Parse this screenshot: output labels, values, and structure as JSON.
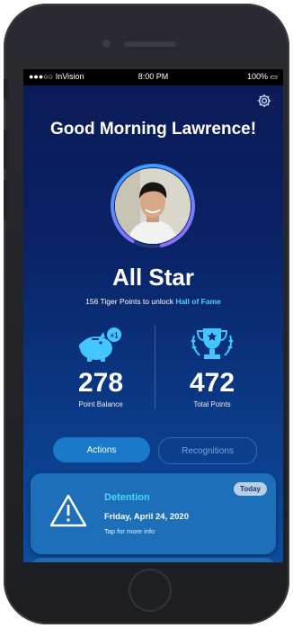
{
  "status_bar": {
    "signal": "●●●○○",
    "carrier": "InVision",
    "time": "8:00 PM",
    "battery": "100%"
  },
  "header": {
    "greeting": "Good Morning Lawrence!",
    "settings_icon": "gear-icon"
  },
  "profile": {
    "rank": "All Star",
    "unlock_prefix": "156 Tiger Points to unlock ",
    "unlock_target": "Hall of Fame",
    "ring_progress": 0.88
  },
  "stats": {
    "balance": {
      "value": "278",
      "label": "Point Balance",
      "icon": "piggy-bank-icon",
      "badge": "+1"
    },
    "total": {
      "value": "472",
      "label": "Total Points",
      "icon": "trophy-icon"
    }
  },
  "tabs": {
    "actions": "Actions",
    "recognitions": "Recognitions"
  },
  "card": {
    "icon": "warning-icon",
    "badge": "Today",
    "title": "Detention",
    "date": "Friday, April 24, 2020",
    "hint": "Tap for more info"
  },
  "colors": {
    "accent": "#4ed2ff",
    "ring_start": "#2aa7ff",
    "ring_end": "#a064ff",
    "card": "#1c6fb8"
  }
}
